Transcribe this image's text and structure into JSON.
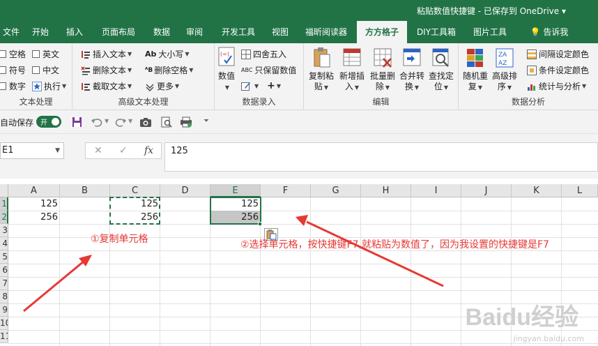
{
  "window": {
    "title": "粘贴数值快捷键 - 已保存到 OneDrive ▾"
  },
  "tabs": [
    "文件",
    "开始",
    "插入",
    "页面布局",
    "数据",
    "审阅",
    "开发工具",
    "视图",
    "福昕阅读器",
    "方方格子",
    "DIY工具箱",
    "图片工具",
    "告诉我"
  ],
  "active_tab": "方方格子",
  "ribbon": {
    "text_group": {
      "label": "文本处理",
      "items": [
        "空格",
        "英文",
        "符号",
        "中文",
        "数字",
        "执行"
      ]
    },
    "adv_text_group": {
      "label": "高级文本处理",
      "items": [
        "插入文本",
        "删除文本",
        "截取文本",
        "大小写",
        "删除空格",
        "更多"
      ]
    },
    "data_entry_group": {
      "label": "数据录入",
      "big": "数值",
      "items": [
        "四舍五入",
        "只保留数值"
      ]
    },
    "edit_group": {
      "label": "编辑",
      "buttons": [
        {
          "line1": "复制粘",
          "line2": "贴"
        },
        {
          "line1": "新增插",
          "line2": "入"
        },
        {
          "line1": "批量删",
          "line2": "除"
        },
        {
          "line1": "合并转",
          "line2": "换"
        },
        {
          "line1": "查找定",
          "line2": "位"
        }
      ]
    },
    "analysis_group": {
      "label": "数据分析",
      "buttons": [
        {
          "line1": "随机重",
          "line2": "复"
        },
        {
          "line1": "高级排",
          "line2": "序"
        }
      ],
      "items": [
        "间隔设定颜色",
        "条件设定颜色",
        "统计与分析"
      ]
    }
  },
  "qat": {
    "autosave_label": "自动保存",
    "toggle_label": "开"
  },
  "formula_bar": {
    "name_box": "E1",
    "formula": "125",
    "fx": "fx"
  },
  "grid": {
    "columns": [
      "A",
      "B",
      "C",
      "D",
      "E",
      "F",
      "G",
      "H",
      "I",
      "J",
      "K",
      "L"
    ],
    "rows": [
      "1",
      "2",
      "3",
      "4",
      "5",
      "6",
      "7",
      "8",
      "9",
      "10",
      "11"
    ],
    "cells": {
      "A1": "125",
      "A2": "256",
      "C1": "125",
      "C2": "256",
      "E1": "125",
      "E2": "256"
    }
  },
  "annotations": {
    "step1": "①复制单元格",
    "step2": "②选择单元格，按快捷键F7,就粘贴为数值了，因为我设置的快捷键是F7"
  },
  "watermark": {
    "logo": "Baidu经验",
    "url": "jingyan.baidu.com"
  },
  "colors": {
    "excel_green": "#217346",
    "annotation_red": "#e53935"
  }
}
